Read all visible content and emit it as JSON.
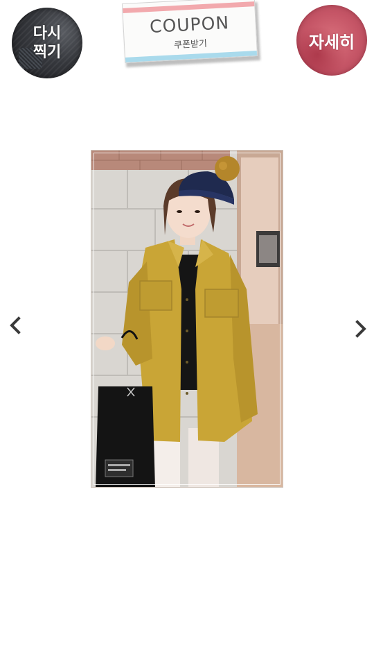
{
  "header": {
    "retake_button": {
      "label_line1": "다시",
      "label_line2": "찍기"
    },
    "coupon": {
      "title": "COUPON",
      "subtitle": "쿠폰받기"
    },
    "detail_button": {
      "label": "자세히"
    }
  },
  "photo": {
    "description_icon": "product-photo-image"
  },
  "navigation": {
    "prev_icon": "chevron-left-icon",
    "next_icon": "chevron-right-icon"
  },
  "colors": {
    "coupon_top_stripe": "#f2a9ad",
    "coupon_bottom_stripe": "#a9daec",
    "detail_button": "#c55566",
    "retake_button": "#35373c",
    "arrow": "#3a3a3a"
  }
}
